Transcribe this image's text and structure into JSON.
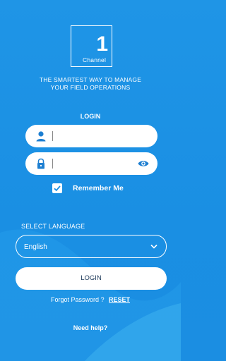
{
  "logo": {
    "number": "1",
    "word": "Channel"
  },
  "tagline": {
    "line1": "THE SMARTEST WAY TO MANAGE",
    "line2": "YOUR FIELD OPERATIONS"
  },
  "login": {
    "title": "LOGIN",
    "username_icon": "user-icon",
    "password_icon": "lock-icon",
    "reveal_icon": "eye-icon",
    "remember_label": "Remember Me",
    "remember_checked": true
  },
  "language": {
    "label": "SELECT LANGUAGE",
    "selected": "English",
    "icon": "chevron-down-icon"
  },
  "actions": {
    "login_button": "LOGIN",
    "forgot_text": "Forgot Password ?",
    "reset_link": "RESET",
    "help_link": "Need help?"
  },
  "colors": {
    "background": "#1a8fe3",
    "icon_blue": "#1e7fd1",
    "button_text": "#1e3a5a"
  }
}
